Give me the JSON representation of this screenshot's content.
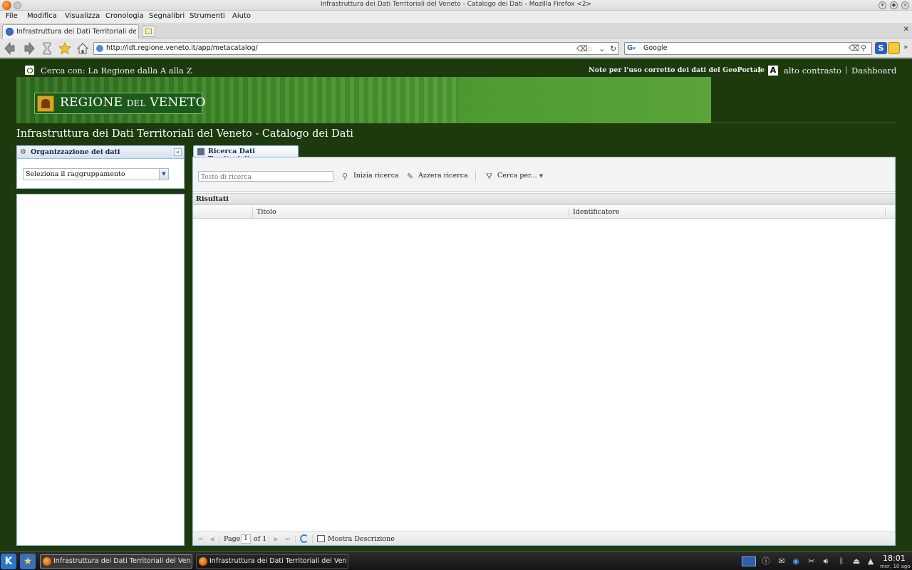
{
  "window": {
    "title": "Infrastruttura dei Dati Territoriali del Veneto - Catalogo dei Dati - Mozilla Firefox <2>"
  },
  "menu": {
    "items": [
      "File",
      "Modifica",
      "Visualizza",
      "Cronologia",
      "Segnalibri",
      "Strumenti",
      "Aiuto"
    ]
  },
  "browser_tab": {
    "label": "Infrastruttura dei Dati Territoriali de..."
  },
  "navbar": {
    "url": "http://idt.regione.veneto.it/app/metacatalog/",
    "search_engine": "Google"
  },
  "site": {
    "topnav": {
      "cerca_link": "Cerca con: La Regione dalla A alla Z",
      "note_link": "Note per l'uso corretto dei dati del GeoPortale",
      "separator": "|",
      "contrast_icon": "A",
      "contrast_link": "alto contrasto",
      "dashboard_link": "Dashboard"
    },
    "logo": {
      "part1": "REGIONE ",
      "part2": "DEL",
      "part3": " VENETO"
    },
    "page_title": "Infrastruttura dei Dati Territoriali del Veneto - Catalogo dei Dati"
  },
  "org_panel": {
    "title": "Organizzazione dei dati",
    "select_value": "Seleziona il raggruppamento"
  },
  "search_panel": {
    "tab_label": "Ricerca Dati Territoriali",
    "search_placeholder": "Testo di ricerca",
    "start_search": "Inizia ricerca",
    "reset_search": "Azzera ricerca",
    "search_by": "Cerca per...",
    "results_title": "Risultati",
    "columns": [
      "",
      "Titolo",
      "Identificatore"
    ]
  },
  "pager": {
    "page_label": "Page",
    "page_value": "1",
    "of_label": "of 1",
    "show_description": "Mostra Descrizione"
  },
  "taskbar": {
    "tasks": [
      "Infrastruttura dei Dati Territoriali del Veneto",
      "Infrastruttura dei Dati Territoriali del Veneto"
    ],
    "time": "18:01",
    "date": "mer, 10 ago"
  }
}
